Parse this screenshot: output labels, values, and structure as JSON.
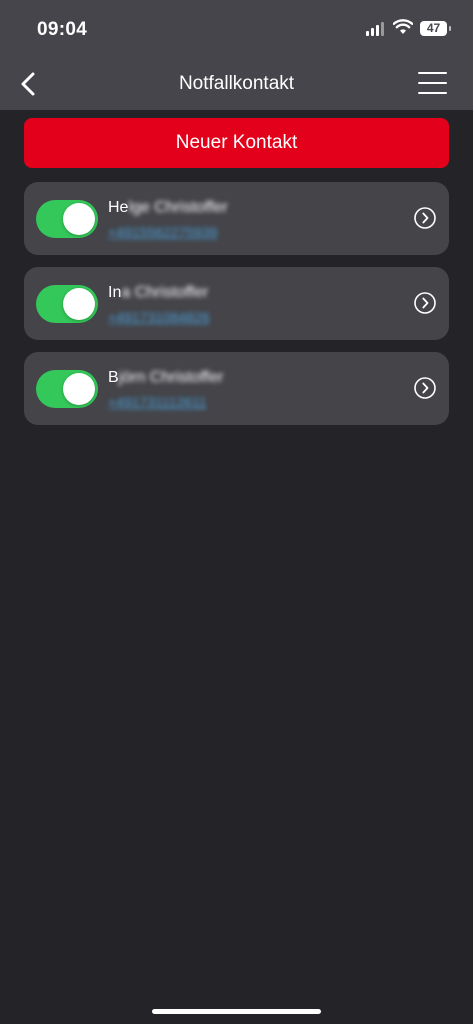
{
  "status_bar": {
    "time": "09:04",
    "battery": "47",
    "signal_icon": "cellular-signal-icon",
    "wifi_icon": "wifi-icon"
  },
  "nav": {
    "title": "Notfallkontakt",
    "back_icon": "chevron-left-icon",
    "menu_icon": "hamburger-menu-icon"
  },
  "new_contact_label": "Neuer Kontakt",
  "contacts": [
    {
      "name_visible": "He",
      "name_blurred": "lge Christoffer",
      "phone": "+4915562275939",
      "enabled": true
    },
    {
      "name_visible": "In",
      "name_blurred": "a Christoffer",
      "phone": "+491731084826",
      "enabled": true
    },
    {
      "name_visible": "B",
      "name_blurred": "jörn Christoffer",
      "phone": "+491731112611",
      "enabled": true
    }
  ],
  "colors": {
    "accent_red": "#e2001a",
    "toggle_on": "#34c759",
    "background": "#242428",
    "card": "#444449",
    "header": "#45454b",
    "link": "#4a9fd8"
  }
}
